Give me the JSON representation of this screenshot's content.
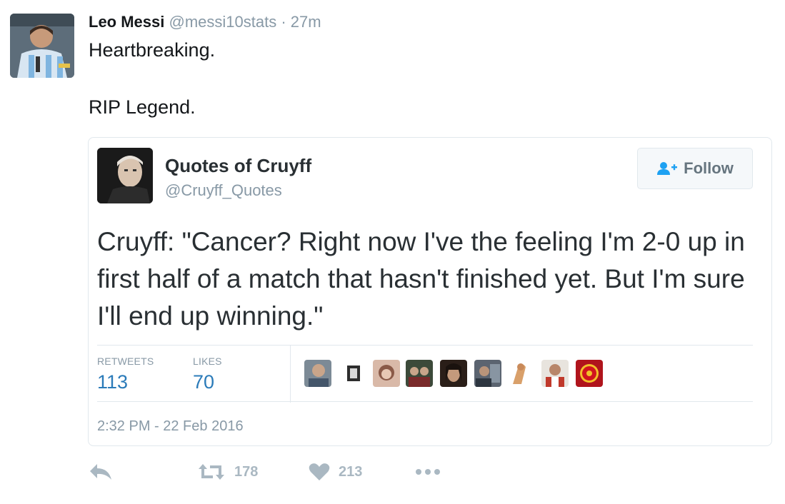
{
  "tweet": {
    "author_name": "Leo Messi",
    "author_handle": "@messi10stats",
    "separator": "·",
    "time_ago": "27m",
    "text_line1": "Heartbreaking.",
    "text_line2": "RIP Legend.",
    "avatar_icon": "profile-photo-argentina-jersey"
  },
  "quoted_tweet": {
    "author_name": "Quotes of Cruyff",
    "author_handle": "@Cruyff_Quotes",
    "follow_label": "Follow",
    "text": "Cruyff: \"Cancer? Right now I've the feeling I'm 2-0 up in first half of a match that hasn't finished yet. But I'm sure I'll end up winning.\"",
    "retweets_label": "RETWEETS",
    "retweets_count": "113",
    "likes_label": "LIKES",
    "likes_count": "70",
    "timestamp": "2:32 PM - 22 Feb 2016",
    "liker_avatars": [
      "avatar-1",
      "avatar-2",
      "avatar-3",
      "avatar-4",
      "avatar-5",
      "avatar-6",
      "avatar-7",
      "avatar-8",
      "avatar-9"
    ]
  },
  "actions": {
    "reply_icon": "reply-icon",
    "retweet_icon": "retweet-icon",
    "retweet_count": "178",
    "like_icon": "heart-icon",
    "like_count": "213",
    "more_icon": "more-icon"
  },
  "colors": {
    "link_blue": "#2b7bb9",
    "muted_gray": "#8899a6",
    "action_gray": "#aab8c2"
  }
}
